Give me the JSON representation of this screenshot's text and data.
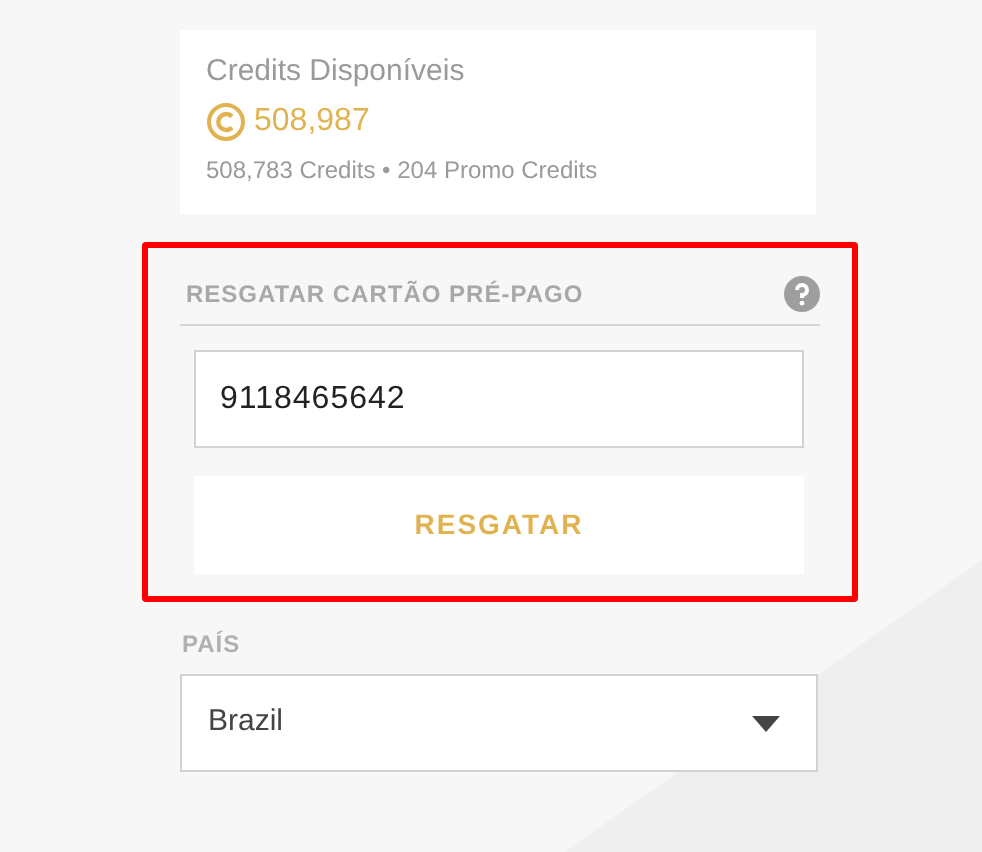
{
  "credits_card": {
    "title": "Credits Disponíveis",
    "total": "508,987",
    "breakdown": "508,783 Credits • 204 Promo Credits"
  },
  "redeem_section": {
    "highlighted": true,
    "heading": "RESGATAR CARTÃO PRÉ-PAGO",
    "code_field": {
      "value": "9118465642"
    },
    "button": "RESGATAR"
  },
  "country": {
    "label": "PAÍS",
    "value": "Brazil"
  }
}
